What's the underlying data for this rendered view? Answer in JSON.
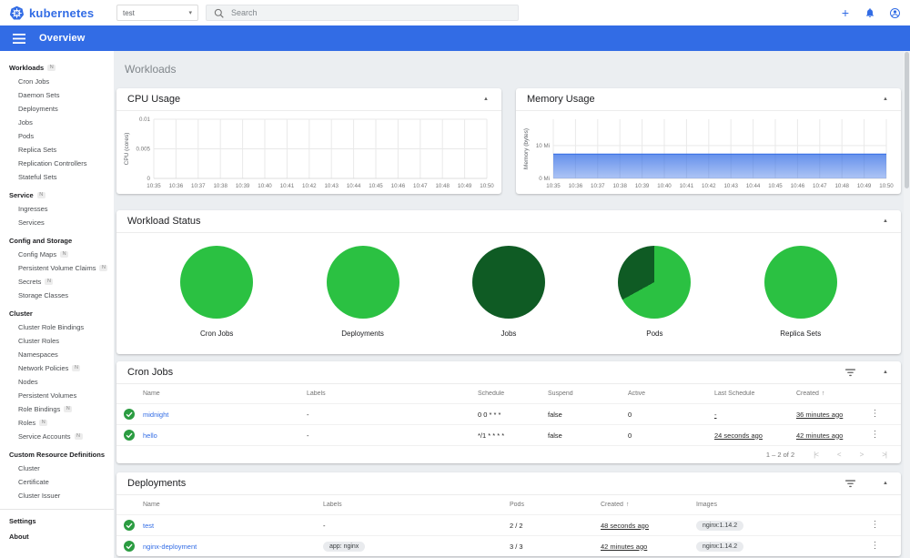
{
  "colors": {
    "accent_blue": "#326ce5",
    "link_blue": "#326ce5",
    "pie_green_bright": "#2bc142",
    "pie_green_dark": "#0f5b24",
    "check_green": "#2b9c41",
    "memory_fill": "#326ce5"
  },
  "icons": {
    "caret_up": "▲",
    "caret_down": "▾",
    "menu_dots": "⋮",
    "sort_asc": "↑",
    "plus": "+",
    "first_page": "|<",
    "prev_page": "<",
    "next_page": ">",
    "last_page": ">|",
    "badge_namespaced": "N"
  },
  "header": {
    "brand": "kubernetes",
    "namespace_value": "test",
    "search_placeholder": "Search"
  },
  "toolbar": {
    "title": "Overview"
  },
  "sidebar": {
    "sections": [
      {
        "label": "Workloads",
        "badge": "N",
        "items": [
          {
            "label": "Cron Jobs"
          },
          {
            "label": "Daemon Sets"
          },
          {
            "label": "Deployments"
          },
          {
            "label": "Jobs"
          },
          {
            "label": "Pods"
          },
          {
            "label": "Replica Sets"
          },
          {
            "label": "Replication Controllers"
          },
          {
            "label": "Stateful Sets"
          }
        ]
      },
      {
        "label": "Service",
        "badge": "N",
        "items": [
          {
            "label": "Ingresses"
          },
          {
            "label": "Services"
          }
        ]
      },
      {
        "label": "Config and Storage",
        "items": [
          {
            "label": "Config Maps",
            "badge": "N"
          },
          {
            "label": "Persistent Volume Claims",
            "badge": "N"
          },
          {
            "label": "Secrets",
            "badge": "N"
          },
          {
            "label": "Storage Classes"
          }
        ]
      },
      {
        "label": "Cluster",
        "items": [
          {
            "label": "Cluster Role Bindings"
          },
          {
            "label": "Cluster Roles"
          },
          {
            "label": "Namespaces"
          },
          {
            "label": "Network Policies",
            "badge": "N"
          },
          {
            "label": "Nodes"
          },
          {
            "label": "Persistent Volumes"
          },
          {
            "label": "Role Bindings",
            "badge": "N"
          },
          {
            "label": "Roles",
            "badge": "N"
          },
          {
            "label": "Service Accounts",
            "badge": "N"
          }
        ]
      },
      {
        "label": "Custom Resource Definitions",
        "items": [
          {
            "label": "Cluster"
          },
          {
            "label": "Certificate"
          },
          {
            "label": "Cluster Issuer"
          }
        ]
      }
    ],
    "footer_items": [
      {
        "label": "Settings"
      },
      {
        "label": "About"
      }
    ]
  },
  "page": {
    "title": "Workloads"
  },
  "chart_data": [
    {
      "type": "line",
      "title": "CPU Usage",
      "ylabel": "CPU (cores)",
      "ymax": 0.01,
      "yticks": [
        {
          "value": 0,
          "label": "0"
        },
        {
          "value": 0.005,
          "label": "0.005"
        },
        {
          "value": 0.01,
          "label": "0.01"
        }
      ],
      "x": [
        "10:35",
        "10:36",
        "10:37",
        "10:38",
        "10:39",
        "10:40",
        "10:41",
        "10:42",
        "10:43",
        "10:44",
        "10:45",
        "10:46",
        "10:47",
        "10:48",
        "10:49",
        "10:50"
      ],
      "series": []
    },
    {
      "type": "area",
      "title": "Memory Usage",
      "ylabel": "Memory (bytes)",
      "ymax": 18,
      "yticks": [
        {
          "value": 0,
          "label": "0 Mi"
        },
        {
          "value": 10,
          "label": "10 Mi"
        }
      ],
      "x": [
        "10:35",
        "10:36",
        "10:37",
        "10:38",
        "10:39",
        "10:40",
        "10:41",
        "10:42",
        "10:43",
        "10:44",
        "10:45",
        "10:46",
        "10:47",
        "10:48",
        "10:49",
        "10:50"
      ],
      "series": [
        {
          "name": "memory usage",
          "values": [
            7.4,
            7.4,
            7.4,
            7.4,
            7.4,
            7.4,
            7.4,
            7.4,
            7.4,
            7.4,
            7.4,
            7.4,
            7.4,
            7.4,
            7.4,
            7.4
          ]
        }
      ],
      "fill": "#326ce5"
    }
  ],
  "workload_status": {
    "title": "Workload Status",
    "pies": [
      {
        "label": "Cron Jobs",
        "slices": [
          {
            "color": "#2bc142",
            "pct": 100
          }
        ]
      },
      {
        "label": "Deployments",
        "slices": [
          {
            "color": "#2bc142",
            "pct": 100
          }
        ]
      },
      {
        "label": "Jobs",
        "slices": [
          {
            "color": "#0f5b24",
            "pct": 100
          }
        ]
      },
      {
        "label": "Pods",
        "slices": [
          {
            "color": "#2bc142",
            "pct": 67
          },
          {
            "color": "#0f5b24",
            "pct": 33
          }
        ]
      },
      {
        "label": "Replica Sets",
        "slices": [
          {
            "color": "#2bc142",
            "pct": 100
          }
        ]
      }
    ]
  },
  "cron_jobs_card": {
    "title": "Cron Jobs",
    "columns": [
      {
        "label": "Name",
        "field": "name",
        "render": "link"
      },
      {
        "label": "Labels",
        "field": "labels",
        "render": "text"
      },
      {
        "label": "Schedule",
        "field": "schedule",
        "render": "text"
      },
      {
        "label": "Suspend",
        "field": "suspend",
        "render": "text"
      },
      {
        "label": "Active",
        "field": "active",
        "render": "text"
      },
      {
        "label": "Last Schedule",
        "field": "last_schedule",
        "render": "underline"
      },
      {
        "label": "Created",
        "field": "created",
        "render": "underline",
        "sort": "asc"
      }
    ],
    "rows": [
      {
        "status": "ok",
        "name": "midnight",
        "labels": "-",
        "schedule": "0 0 * * *",
        "suspend": "false",
        "active": "0",
        "last_schedule": "-",
        "created": "36 minutes ago"
      },
      {
        "status": "ok",
        "name": "hello",
        "labels": "-",
        "schedule": "*/1 * * * *",
        "suspend": "false",
        "active": "0",
        "last_schedule": "24 seconds ago",
        "created": "42 minutes ago"
      }
    ],
    "pagination": {
      "range_label": "1 – 2 of 2"
    }
  },
  "deployments_card": {
    "title": "Deployments",
    "columns": [
      {
        "label": "Name",
        "field": "name",
        "render": "link"
      },
      {
        "label": "Labels",
        "field": "labels",
        "render": "chip-or-text"
      },
      {
        "label": "Pods",
        "field": "pods",
        "render": "text"
      },
      {
        "label": "Created",
        "field": "created",
        "render": "underline",
        "sort": "asc"
      },
      {
        "label": "Images",
        "field": "images",
        "render": "chip"
      }
    ],
    "rows": [
      {
        "status": "ok",
        "name": "test",
        "labels": "-",
        "pods": "2 / 2",
        "created": "48 seconds ago",
        "images": "nginx:1.14.2"
      },
      {
        "status": "ok",
        "name": "nginx-deployment",
        "labels": "app: nginx",
        "pods": "3 / 3",
        "created": "42 minutes ago",
        "images": "nginx:1.14.2"
      }
    ]
  }
}
